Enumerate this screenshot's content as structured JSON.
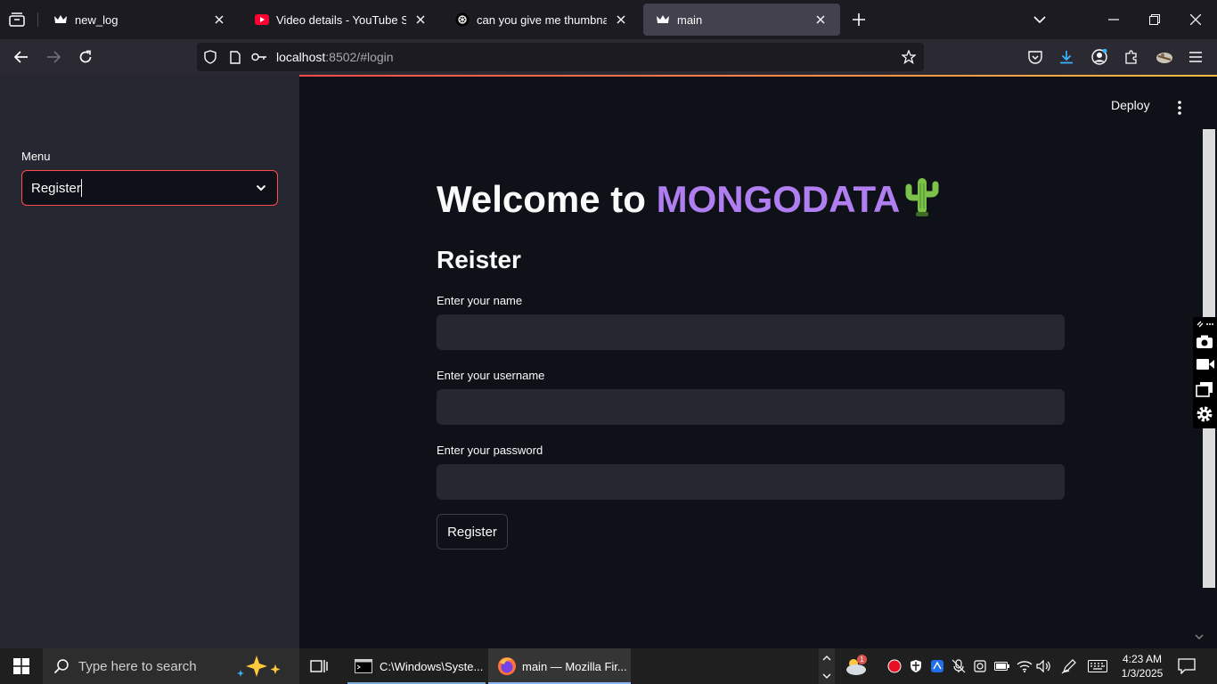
{
  "browser": {
    "tabs": [
      {
        "title": "new_log",
        "favicon": "streamlit-crown-icon",
        "active": false
      },
      {
        "title": "Video details - YouTube Studio",
        "favicon": "youtube-icon",
        "active": false
      },
      {
        "title": "can you give me thumbnail for",
        "favicon": "chatgpt-icon",
        "active": false
      },
      {
        "title": "main",
        "favicon": "streamlit-crown-icon",
        "active": true
      }
    ],
    "url_host": "localhost",
    "url_rest": ":8502/#login"
  },
  "sidebar": {
    "menu_label": "Menu",
    "menu_value": "Register"
  },
  "header": {
    "deploy_label": "Deploy"
  },
  "main": {
    "title_prefix": "Welcome to ",
    "title_brand": "MONGODATA",
    "subtitle": "Reister",
    "fields": [
      {
        "label": "Enter your name",
        "value": ""
      },
      {
        "label": "Enter your username",
        "value": ""
      },
      {
        "label": "Enter your password",
        "value": ""
      }
    ],
    "submit_label": "Register"
  },
  "taskbar": {
    "search_placeholder": "Type here to search",
    "apps": [
      {
        "label": "C:\\Windows\\Syste...",
        "icon": "cmd-icon"
      },
      {
        "label": "main — Mozilla Fir...",
        "icon": "firefox-icon",
        "active": true
      }
    ],
    "weather_badge": "1",
    "time": "4:23 AM",
    "date": "1/3/2025"
  },
  "colors": {
    "accent": "#ff4b4b",
    "brand_purple": "#b07ef0",
    "bg_main": "#0e1117",
    "bg_sidebar": "#262730"
  }
}
